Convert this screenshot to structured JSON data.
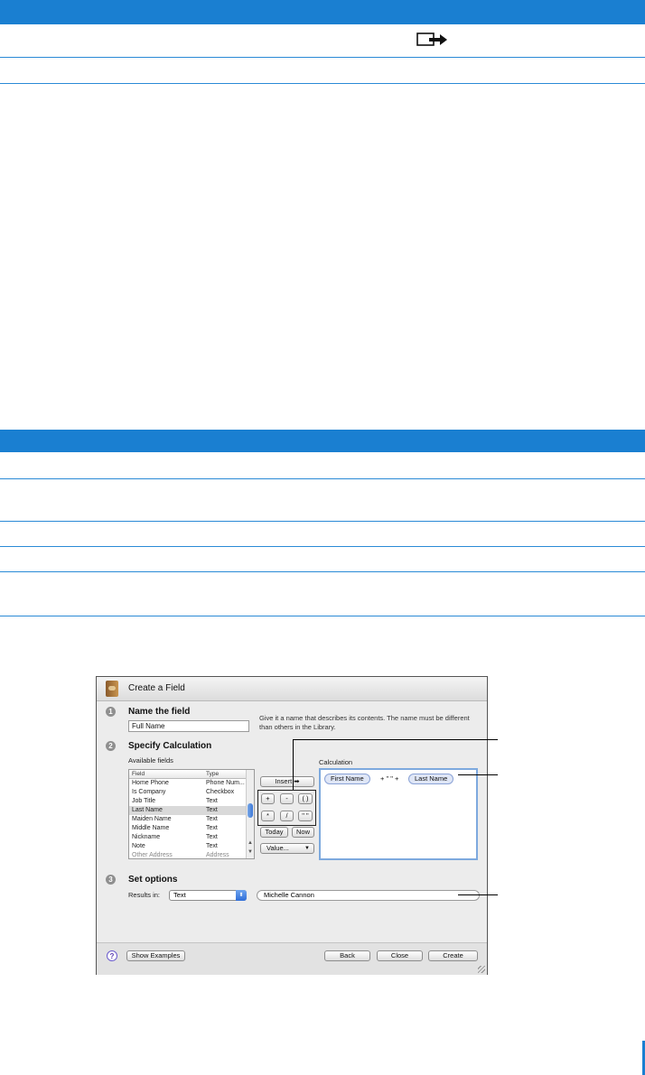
{
  "dialog": {
    "title": "Create a Field",
    "step1": {
      "number": "1",
      "title": "Name the field",
      "name_value": "Full Name",
      "help": "Give it a name that describes its contents. The name must be different than others in the Library."
    },
    "step2": {
      "number": "2",
      "title": "Specify Calculation",
      "available_label": "Available fields",
      "columns": [
        "Field",
        "Type"
      ],
      "rows": [
        {
          "field": "Home Phone",
          "type": "Phone Num..."
        },
        {
          "field": "Is Company",
          "type": "Checkbox"
        },
        {
          "field": "Job Title",
          "type": "Text"
        },
        {
          "field": "Last Name",
          "type": "Text"
        },
        {
          "field": "Maiden Name",
          "type": "Text"
        },
        {
          "field": "Middle Name",
          "type": "Text"
        },
        {
          "field": "Nickname",
          "type": "Text"
        },
        {
          "field": "Note",
          "type": "Text"
        },
        {
          "field": "Other Address",
          "type": "Address"
        }
      ],
      "insert_label": "Insert",
      "operators": [
        "+",
        "-",
        "( )",
        "*",
        "/",
        "\" \""
      ],
      "today_label": "Today",
      "now_label": "Now",
      "value_label": "Value...",
      "calculation_label": "Calculation",
      "calc": {
        "token1": "First Name",
        "middle": "+ \" \" +",
        "token2": "Last Name"
      }
    },
    "step3": {
      "number": "3",
      "title": "Set options",
      "results_label": "Results in:",
      "results_value": "Text",
      "preview_value": "Michelle Cannon"
    },
    "footer": {
      "help_glyph": "?",
      "show_examples": "Show Examples",
      "back": "Back",
      "close": "Close",
      "create": "Create"
    }
  },
  "colors": {
    "accent_blue": "#1a7fd1",
    "dialog_bg": "#ececec"
  }
}
